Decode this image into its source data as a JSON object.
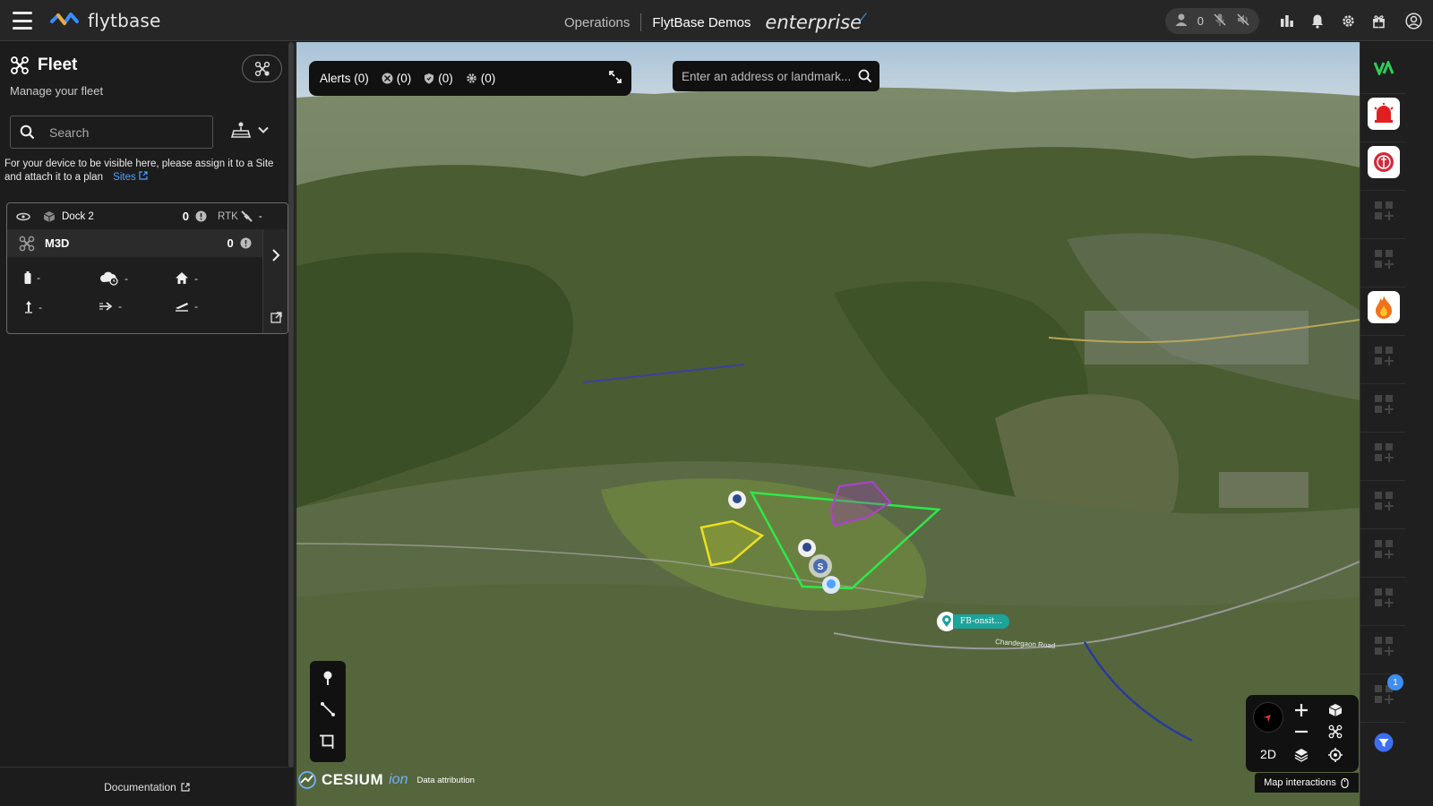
{
  "app": {
    "logo_text": "flytbase",
    "nav_operations": "Operations",
    "org_name": "FlytBase Demos",
    "edition": "enterprise"
  },
  "topbar": {
    "users_count": "0"
  },
  "fleet": {
    "title": "Fleet",
    "subtitle": "Manage your fleet",
    "search_placeholder": "Search",
    "info_text": "For your device to be visible here, please assign it to a Site and attach it to a plan",
    "sites_link": "Sites",
    "dock": {
      "name": "Dock 2",
      "count": "0",
      "rtk_label": "RTK",
      "rtk_value": "-"
    },
    "drone": {
      "name": "M3D",
      "count": "0"
    },
    "stats": {
      "battery": "-",
      "weather": "-",
      "home": "-",
      "altitude": "-",
      "speed": "-",
      "flight": "-"
    },
    "documentation": "Documentation"
  },
  "map": {
    "alerts_label": "Alerts (0)",
    "alert_counts": [
      "(0)",
      "(0)",
      "(0)"
    ],
    "address_placeholder": "Enter an address or landmark...",
    "view_mode": "2D",
    "map_interactions": "Map interactions",
    "cesium_brand": "CESIUM",
    "cesium_ion": "ion",
    "attribution": "Data attribution",
    "onsite_label": "FB-onsit...",
    "road_label": "Chandegaon Road",
    "marker_s_label": "S"
  },
  "rail": {
    "badge_count": "1"
  },
  "colors": {
    "accent": "#3e8ff0",
    "geofence_green": "#2ee84a",
    "zone_yellow": "#e8e020",
    "zone_purple": "#b040d0",
    "onsite_teal": "#1ca39a"
  }
}
